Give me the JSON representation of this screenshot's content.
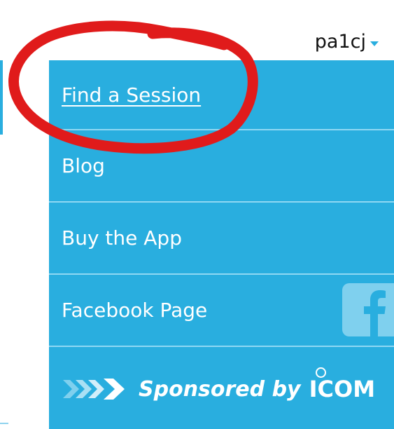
{
  "user": {
    "name": "pa1cj"
  },
  "menu": {
    "items": [
      {
        "label": "Find a Session",
        "active": true
      },
      {
        "label": "Blog"
      },
      {
        "label": "Buy the App"
      },
      {
        "label": "Facebook Page",
        "icon": "facebook-icon"
      }
    ]
  },
  "sponsor": {
    "text": "Sponsored by",
    "brand": "ICOM",
    "icon": "chevron-arrows-icon"
  },
  "annotation": {
    "type": "red-circle",
    "color": "#e01b1b",
    "target": "Find a Session"
  },
  "colors": {
    "menu_background": "#29aedf",
    "divider": "#8fd8f3",
    "facebook_icon_bg": "#7fd0ee",
    "caret": "#29aedf"
  }
}
